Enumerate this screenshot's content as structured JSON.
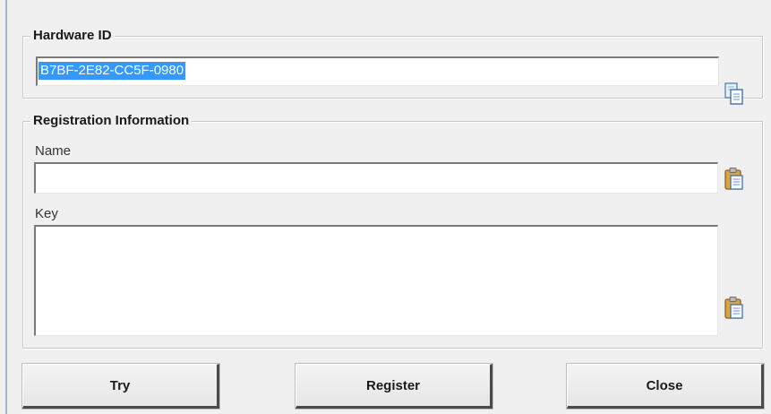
{
  "hardware": {
    "legend": "Hardware ID",
    "id_value": "B7BF-2E82-CC5F-0980",
    "copy_icon": "copy-icon"
  },
  "registration": {
    "legend": "Registration Information",
    "name_label": "Name",
    "name_value": "",
    "key_label": "Key",
    "key_value": "",
    "paste_icon": "paste-icon"
  },
  "buttons": {
    "try": "Try",
    "register": "Register",
    "close": "Close"
  },
  "colors": {
    "selection": "#3399ff",
    "window_bg": "#f0f0f0"
  }
}
